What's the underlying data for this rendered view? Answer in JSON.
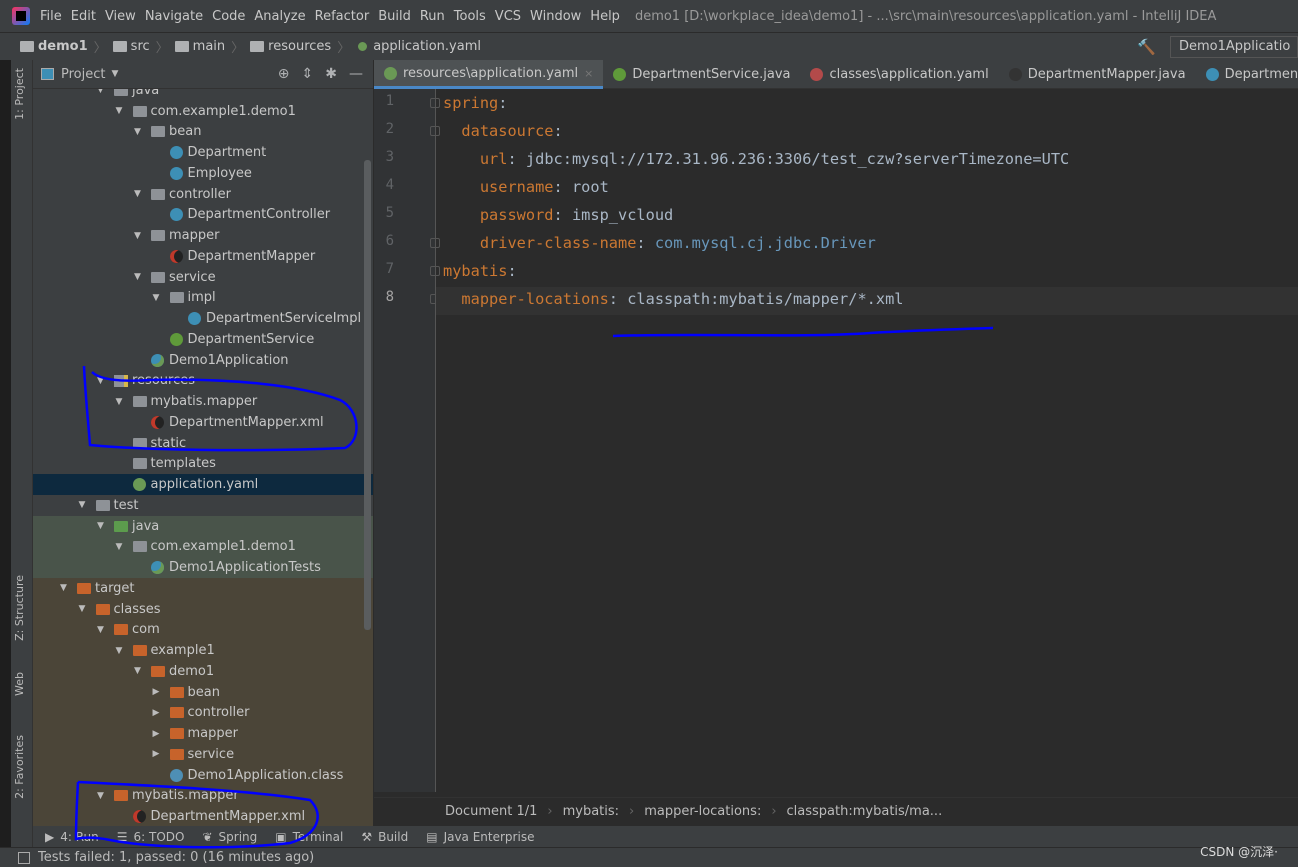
{
  "menu": {
    "items": [
      "File",
      "Edit",
      "View",
      "Navigate",
      "Code",
      "Analyze",
      "Refactor",
      "Build",
      "Run",
      "Tools",
      "VCS",
      "Window",
      "Help"
    ],
    "window_title": "demo1 [D:\\workplace_idea\\demo1] - ...\\src\\main\\resources\\application.yaml - IntelliJ IDEA"
  },
  "breadcrumb": [
    "demo1",
    "src",
    "main",
    "resources",
    "application.yaml"
  ],
  "run_config": "Demo1Applicatio",
  "side_tabs": {
    "project": "1: Project",
    "structure": "Z: Structure",
    "web": "Web",
    "favorites": "2: Favorites"
  },
  "project": {
    "title": "Project",
    "tree": [
      {
        "label": "java",
        "level": 3,
        "type": "folder",
        "arrow": "down"
      },
      {
        "label": "com.example1.demo1",
        "level": 4,
        "type": "folder",
        "arrow": "down"
      },
      {
        "label": "bean",
        "level": 5,
        "type": "folder",
        "arrow": "down"
      },
      {
        "label": "Department",
        "level": 6,
        "type": "cls"
      },
      {
        "label": "Employee",
        "level": 6,
        "type": "cls"
      },
      {
        "label": "controller",
        "level": 5,
        "type": "folder",
        "arrow": "down"
      },
      {
        "label": "DepartmentController",
        "level": 6,
        "type": "cls"
      },
      {
        "label": "mapper",
        "level": 5,
        "type": "folder",
        "arrow": "down"
      },
      {
        "label": "DepartmentMapper",
        "level": 6,
        "type": "mb"
      },
      {
        "label": "service",
        "level": 5,
        "type": "folder",
        "arrow": "down"
      },
      {
        "label": "impl",
        "level": 6,
        "type": "folder",
        "arrow": "down"
      },
      {
        "label": "DepartmentServiceImpl",
        "level": 7,
        "type": "cls"
      },
      {
        "label": "DepartmentService",
        "level": 6,
        "type": "iface"
      },
      {
        "label": "Demo1Application",
        "level": 5,
        "type": "app"
      },
      {
        "label": "resources",
        "level": 3,
        "type": "res",
        "arrow": "down"
      },
      {
        "label": "mybatis.mapper",
        "level": 4,
        "type": "folder",
        "arrow": "down"
      },
      {
        "label": "DepartmentMapper.xml",
        "level": 5,
        "type": "mb"
      },
      {
        "label": "static",
        "level": 4,
        "type": "folder"
      },
      {
        "label": "templates",
        "level": 4,
        "type": "folder"
      },
      {
        "label": "application.yaml",
        "level": 4,
        "type": "yaml",
        "selected": true
      },
      {
        "label": "test",
        "level": 2,
        "type": "folder",
        "arrow": "down"
      },
      {
        "label": "java",
        "level": 3,
        "type": "gfolder",
        "arrow": "down",
        "bg": "test"
      },
      {
        "label": "com.example1.demo1",
        "level": 4,
        "type": "folder",
        "arrow": "down",
        "bg": "test"
      },
      {
        "label": "Demo1ApplicationTests",
        "level": 5,
        "type": "app",
        "bg": "test"
      },
      {
        "label": "target",
        "level": 1,
        "type": "ofolder",
        "arrow": "down",
        "bg": "target"
      },
      {
        "label": "classes",
        "level": 2,
        "type": "ofolder",
        "arrow": "down",
        "bg": "target"
      },
      {
        "label": "com",
        "level": 3,
        "type": "ofolder",
        "arrow": "down",
        "bg": "target"
      },
      {
        "label": "example1",
        "level": 4,
        "type": "ofolder",
        "arrow": "down",
        "bg": "target"
      },
      {
        "label": "demo1",
        "level": 5,
        "type": "ofolder",
        "arrow": "down",
        "bg": "target"
      },
      {
        "label": "bean",
        "level": 6,
        "type": "ofolder",
        "arrow": "right",
        "bg": "target"
      },
      {
        "label": "controller",
        "level": 6,
        "type": "ofolder",
        "arrow": "right",
        "bg": "target"
      },
      {
        "label": "mapper",
        "level": 6,
        "type": "ofolder",
        "arrow": "right",
        "bg": "target"
      },
      {
        "label": "service",
        "level": 6,
        "type": "ofolder",
        "arrow": "right",
        "bg": "target"
      },
      {
        "label": "Demo1Application.class",
        "level": 6,
        "type": "file",
        "bg": "target"
      },
      {
        "label": "mybatis.mapper",
        "level": 3,
        "type": "ofolder",
        "arrow": "down",
        "bg": "target"
      },
      {
        "label": "DepartmentMapper.xml",
        "level": 4,
        "type": "mb",
        "bg": "target"
      }
    ]
  },
  "tabs": [
    {
      "label": "resources\\application.yaml",
      "color": "#6a9955",
      "active": true,
      "close": "×"
    },
    {
      "label": "DepartmentService.java",
      "color": "#5f9a3a"
    },
    {
      "label": "classes\\application.yaml",
      "color": "#b34a4a"
    },
    {
      "label": "DepartmentMapper.java",
      "color": "#333333"
    },
    {
      "label": "DepartmentCo",
      "color": "#3d8fb5"
    }
  ],
  "editor": {
    "lines": [
      {
        "n": "1",
        "key": "spring",
        "indent": 0
      },
      {
        "n": "2",
        "key": "datasource",
        "indent": 1
      },
      {
        "n": "3",
        "key": "url",
        "indent": 2,
        "value": "jdbc:mysql://172.31.96.236:3306/test_czw?serverTimezone=UTC"
      },
      {
        "n": "4",
        "key": "username",
        "indent": 2,
        "value": "root"
      },
      {
        "n": "5",
        "key": "password",
        "indent": 2,
        "value": "imsp_vcloud"
      },
      {
        "n": "6",
        "key": "driver-class-name",
        "indent": 2,
        "value": "com.mysql.cj.jdbc.Driver",
        "vclass": "c"
      },
      {
        "n": "7",
        "key": "mybatis",
        "indent": 0
      },
      {
        "n": "8",
        "key": "mapper-locations",
        "indent": 1,
        "value": "classpath:mybatis/mapper/*.xml"
      }
    ]
  },
  "editor_breadcrumb": [
    "Document 1/1",
    "mybatis:",
    "mapper-locations:",
    "classpath:mybatis/ma..."
  ],
  "toolwindows": [
    "4: Run",
    "6: TODO",
    "Spring",
    "Terminal",
    "Build",
    "Java Enterprise"
  ],
  "status": "Tests failed: 1, passed: 0 (16 minutes ago)",
  "watermark": "CSDN @沉泽·",
  "colors": {
    "annotation": "#0000ff",
    "selection": "#0d293e",
    "test_bg": "#49544a",
    "target_bg": "#4b4538"
  }
}
